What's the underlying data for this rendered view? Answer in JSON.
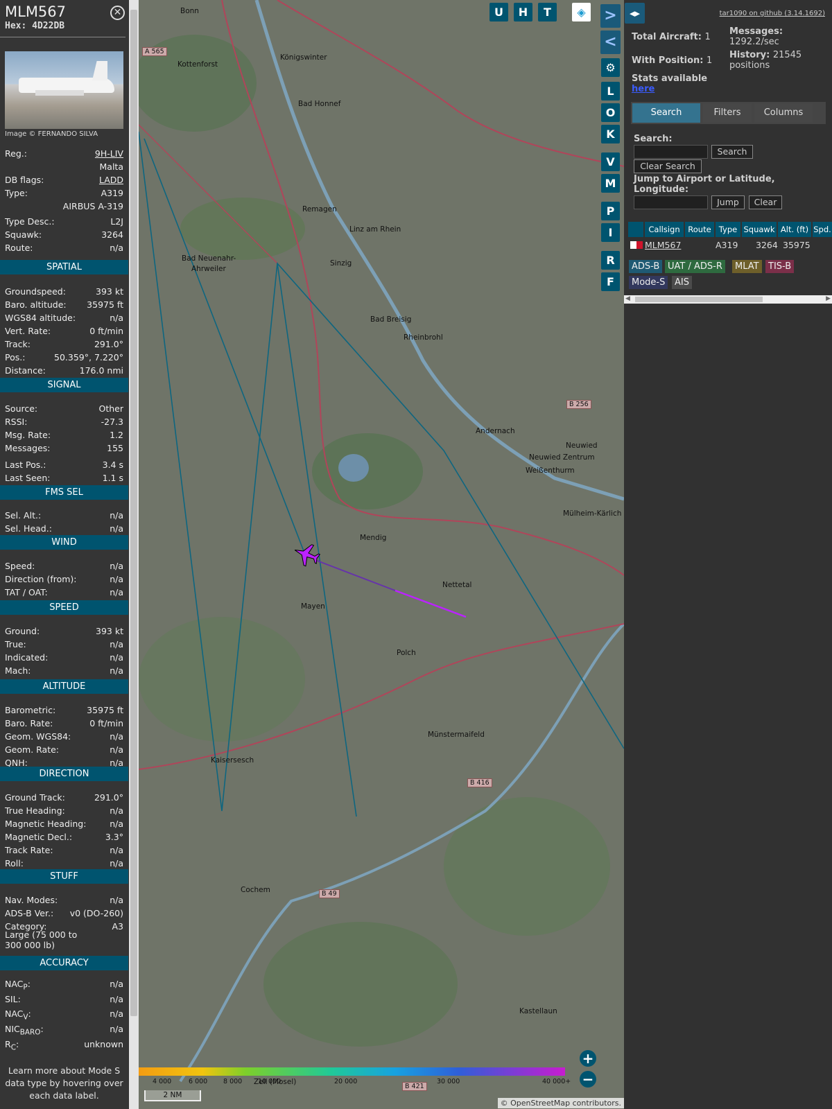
{
  "aircraft": {
    "callsign": "MLM567",
    "hex_label": "Hex:",
    "hex": "4D22DB",
    "image_credit": "Image © FERNANDO SILVA",
    "reg_label": "Reg.:",
    "reg": "9H-LIV",
    "country": "Malta",
    "dbflags_label": "DB flags:",
    "dbflags": "LADD",
    "type_label": "Type:",
    "type": "A319",
    "type_full": "AIRBUS A-319",
    "typedesc_label": "Type Desc.:",
    "typedesc": "L2J",
    "squawk_label": "Squawk:",
    "squawk": "3264",
    "route_label": "Route:",
    "route": "n/a"
  },
  "sections": {
    "spatial": "SPATIAL",
    "signal": "SIGNAL",
    "fms": "FMS SEL",
    "wind": "WIND",
    "speed": "SPEED",
    "altitude": "ALTITUDE",
    "direction": "DIRECTION",
    "stuff": "STUFF",
    "accuracy": "ACCURACY"
  },
  "spatial": [
    [
      "Groundspeed:",
      "393 kt"
    ],
    [
      "Baro. altitude:",
      "35975 ft"
    ],
    [
      "WGS84 altitude:",
      "n/a"
    ],
    [
      "Vert. Rate:",
      "0 ft/min"
    ],
    [
      "Track:",
      "291.0°"
    ],
    [
      "Pos.:",
      "50.359°, 7.220°"
    ],
    [
      "Distance:",
      "176.0 nmi"
    ]
  ],
  "signal": [
    [
      "Source:",
      "Other"
    ],
    [
      "RSSI:",
      "-27.3"
    ],
    [
      "Msg. Rate:",
      "1.2"
    ],
    [
      "Messages:",
      "155"
    ],
    [
      "Last Pos.:",
      "3.4 s"
    ],
    [
      "Last Seen:",
      "1.1 s"
    ]
  ],
  "fms": [
    [
      "Sel. Alt.:",
      "n/a"
    ],
    [
      "Sel. Head.:",
      "n/a"
    ]
  ],
  "wind": [
    [
      "Speed:",
      "n/a"
    ],
    [
      "Direction (from):",
      "n/a"
    ],
    [
      "TAT / OAT:",
      "n/a"
    ]
  ],
  "speed": [
    [
      "Ground:",
      "393 kt"
    ],
    [
      "True:",
      "n/a"
    ],
    [
      "Indicated:",
      "n/a"
    ],
    [
      "Mach:",
      "n/a"
    ]
  ],
  "altitude": [
    [
      "Barometric:",
      "35975 ft"
    ],
    [
      "Baro. Rate:",
      "0 ft/min"
    ],
    [
      "Geom. WGS84:",
      "n/a"
    ],
    [
      "Geom. Rate:",
      "n/a"
    ],
    [
      "QNH:",
      "n/a"
    ]
  ],
  "direction": [
    [
      "Ground Track:",
      "291.0°"
    ],
    [
      "True Heading:",
      "n/a"
    ],
    [
      "Magnetic Heading:",
      "n/a"
    ],
    [
      "Magnetic Decl.:",
      "3.3°"
    ],
    [
      "Track Rate:",
      "n/a"
    ],
    [
      "Roll:",
      "n/a"
    ]
  ],
  "stuff": {
    "rows": [
      [
        "Nav. Modes:",
        "n/a"
      ],
      [
        "ADS-B Ver.:",
        "v0 (DO-260)"
      ],
      [
        "Category:",
        "A3"
      ]
    ],
    "category_desc": "Large (75 000 to 300 000 lb)"
  },
  "accuracy": {
    "nacp_k": "NAC",
    "nacp_sub": "P",
    "nacp_v": "n/a",
    "sil_k": "SIL:",
    "sil_v": "n/a",
    "nacv_k": "NAC",
    "nacv_sub": "V",
    "nacv_v": "n/a",
    "nicbaro_k": "NIC",
    "nicbaro_sub": "BARO",
    "nicbaro_v": "n/a",
    "rc_k": "R",
    "rc_sub": "C",
    "rc_v": "unknown"
  },
  "help_note": "Learn more about Mode S data type by hovering over each data label.",
  "map_buttons": {
    "u": "U",
    "h": "H",
    "t": "T",
    "l": "L",
    "o": "O",
    "k": "K",
    "v": "V",
    "m": "M",
    "p": "P",
    "i": "I",
    "r": "R",
    "f": "F"
  },
  "map_places": [
    [
      "Königswinter",
      204,
      77
    ],
    [
      "Bad Honnef",
      230,
      144
    ],
    [
      "Remagen",
      236,
      296
    ],
    [
      "Linz am Rhein",
      304,
      325
    ],
    [
      "Bad Neuenahr-",
      62,
      367
    ],
    [
      "Ahrweiler",
      76,
      382
    ],
    [
      "Sinzig",
      276,
      374
    ],
    [
      "Bad Breisig",
      334,
      455
    ],
    [
      "Rheinbrohl",
      382,
      481
    ],
    [
      "Andernach",
      486,
      616
    ],
    [
      "Neuwied",
      616,
      637
    ],
    [
      "Weißenthurm",
      558,
      673
    ],
    [
      "Mülheim-Kärlich",
      612,
      735
    ],
    [
      "Mendig",
      319,
      770
    ],
    [
      "Mayen",
      234,
      869
    ],
    [
      "Polch",
      372,
      936
    ],
    [
      "Münstermaifeld",
      417,
      1054
    ],
    [
      "Kaisersesch",
      104,
      1091
    ],
    [
      "Cochem",
      147,
      1278
    ],
    [
      "Kastellaun",
      549,
      1453
    ],
    [
      "Bonn",
      60,
      10
    ],
    [
      "Kottenforst",
      56,
      87
    ],
    [
      "Nettetal",
      438,
      838
    ],
    [
      "Neuwied Zentrum",
      563,
      654
    ],
    [
      "Zell (Mosel)",
      166,
      1555
    ]
  ],
  "road_shields": [
    [
      "A 565",
      5,
      68
    ],
    [
      "B 256",
      617,
      577
    ],
    [
      "B 416",
      474,
      1123
    ],
    [
      "B 49",
      260,
      1283
    ],
    [
      "B 421",
      380,
      1561
    ]
  ],
  "altitude_scale": [
    "4 000",
    "6 000",
    "8 000",
    "10 000",
    "20 000",
    "30 000",
    "40 000+"
  ],
  "scale_bar": "2 NM",
  "attribution": "© OpenStreetMap contributors.",
  "right": {
    "github": "tar1090 on github (3.14.1692)",
    "total_label": "Total Aircraft:",
    "total": "1",
    "withpos_label": "With Position:",
    "withpos": "1",
    "stats_label": "Stats available",
    "stats_link": "here",
    "messages_label": "Messages:",
    "messages": "1292.2/sec",
    "history_label": "History:",
    "history": "21545 positions",
    "tabs": [
      "Search",
      "Filters",
      "Columns"
    ],
    "search_label": "Search:",
    "search_btn": "Search",
    "clear_search_btn": "Clear Search",
    "jump_label": "Jump to Airport or Latitude, Longitude:",
    "jump_btn": "Jump",
    "clear_btn": "Clear",
    "table_headers": [
      "Callsign",
      "Route",
      "Type",
      "Squawk",
      "Alt. (ft)",
      "Spd."
    ],
    "table_row": {
      "callsign": "MLM567",
      "route": "",
      "type": "A319",
      "squawk": "3264",
      "alt": "35975"
    },
    "sources": [
      "ADS-B",
      "UAT / ADS-R",
      "MLAT",
      "TIS-B",
      "Mode-S",
      "AIS"
    ]
  },
  "colors": {
    "accent": "#00546f",
    "adsb": "#1f5a73",
    "uat": "#2e6a3f",
    "mlat": "#6e5f2a",
    "tisb": "#7b2f49",
    "modes": "#32385d",
    "ais": "#4b4b4b",
    "trail": "#bb22ff"
  }
}
